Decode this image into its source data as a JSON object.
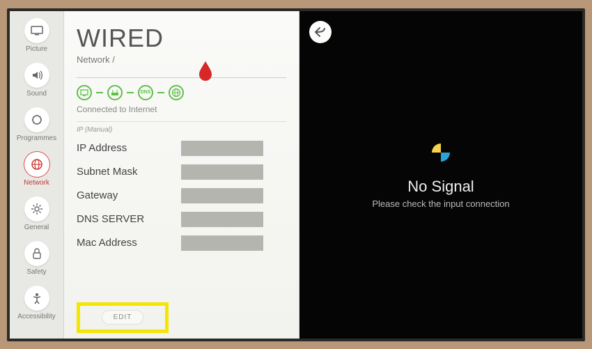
{
  "sidebar": {
    "items": [
      {
        "label": "Picture"
      },
      {
        "label": "Sound"
      },
      {
        "label": "Programmes"
      },
      {
        "label": "Network"
      },
      {
        "label": "General"
      },
      {
        "label": "Safety"
      },
      {
        "label": "Accessibility"
      }
    ]
  },
  "content": {
    "title": "WIRED",
    "breadcrumb": "Network /",
    "status_text": "Connected to Internet",
    "status_nodes": [
      "tv",
      "router",
      "DNS",
      "globe"
    ],
    "ip_mode": "IP (Manual)",
    "fields": [
      {
        "label": "IP Address"
      },
      {
        "label": "Subnet Mask"
      },
      {
        "label": "Gateway"
      },
      {
        "label": "DNS SERVER"
      },
      {
        "label": "Mac Address"
      }
    ],
    "edit_label": "EDIT"
  },
  "screen": {
    "no_signal_title": "No Signal",
    "no_signal_sub": "Please check the input connection"
  }
}
